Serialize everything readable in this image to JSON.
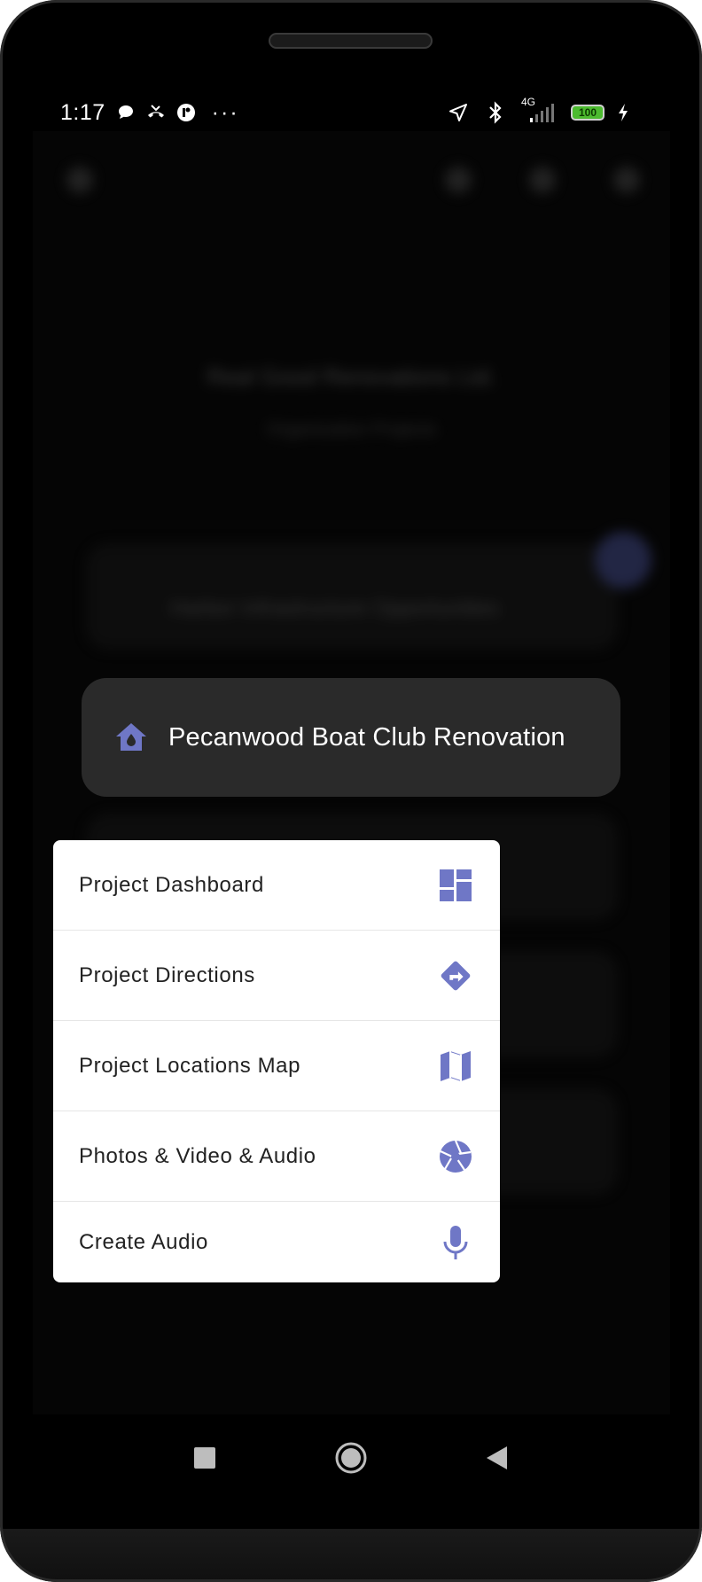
{
  "status_bar": {
    "time": "1:17",
    "more": "···",
    "network": "4G",
    "battery": "100"
  },
  "background": {
    "title": "Real Good Renovations Ltd.",
    "subtitle": "Organization Projects",
    "card_title": "Harbor Infrastructure Opportunities"
  },
  "project": {
    "name": "Pecanwood Boat Club Renovation",
    "icon": "house-water-icon"
  },
  "menu": {
    "items": [
      {
        "label": "Project Dashboard",
        "icon": "dashboard-icon"
      },
      {
        "label": "Project Directions",
        "icon": "directions-icon"
      },
      {
        "label": "Project Locations Map",
        "icon": "map-icon"
      },
      {
        "label": "Photos & Video & Audio",
        "icon": "camera-aperture-icon"
      },
      {
        "label": "Create Audio",
        "icon": "microphone-icon"
      }
    ]
  },
  "colors": {
    "accent": "#6f77c6",
    "card_bg": "#2a2a2a",
    "menu_bg": "#ffffff"
  }
}
